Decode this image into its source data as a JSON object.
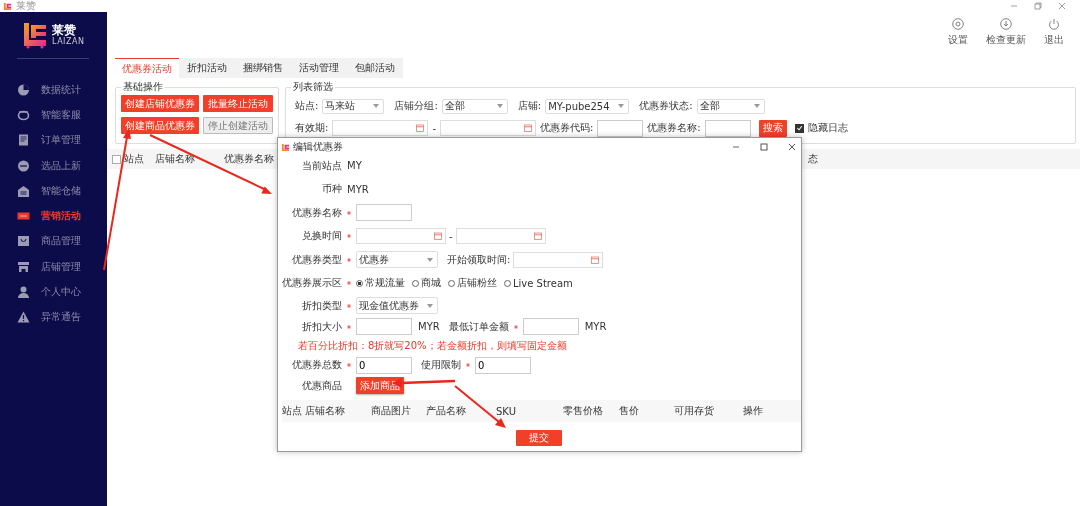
{
  "app_title": "莱赞",
  "logo": {
    "name": "莱赞",
    "subtitle": "LAIZAN"
  },
  "sidebar": {
    "items": [
      {
        "label": "数据统计",
        "kind": "chart",
        "selected": false
      },
      {
        "label": "智能客服",
        "kind": "service",
        "selected": false
      },
      {
        "label": "订单管理",
        "kind": "order",
        "selected": false
      },
      {
        "label": "选品上新",
        "kind": "new",
        "selected": false
      },
      {
        "label": "智能仓储",
        "kind": "warehouse",
        "selected": false
      },
      {
        "label": "营销活动",
        "kind": "sale",
        "selected": true
      },
      {
        "label": "商品管理",
        "kind": "bag",
        "selected": false
      },
      {
        "label": "店铺管理",
        "kind": "store",
        "selected": false
      },
      {
        "label": "个人中心",
        "kind": "person",
        "selected": false
      },
      {
        "label": "异常通告",
        "kind": "warning",
        "selected": false
      }
    ]
  },
  "toolbar": [
    {
      "label": "设置",
      "kind": "settings"
    },
    {
      "label": "检查更新",
      "kind": "update"
    },
    {
      "label": "退出",
      "kind": "power"
    }
  ],
  "tabs": [
    {
      "label": "优惠券活动",
      "selected": true
    },
    {
      "label": "折扣活动",
      "selected": false
    },
    {
      "label": "捆绑销售",
      "selected": false
    },
    {
      "label": "活动管理",
      "selected": false
    },
    {
      "label": "包邮活动",
      "selected": false
    }
  ],
  "basic_ops": {
    "title": "基础操作",
    "buttons": [
      {
        "label": "创建店铺优惠券",
        "disabled": false
      },
      {
        "label": "批量终止活动",
        "disabled": false
      },
      {
        "label": "创建商品优惠券",
        "disabled": false
      },
      {
        "label": "停止创建活动",
        "disabled": true
      }
    ]
  },
  "filters": {
    "title": "列表筛选",
    "selects": [
      {
        "label": "站点:",
        "value": "马来站"
      },
      {
        "label": "店铺分组:",
        "value": "全部"
      },
      {
        "label": "店铺:",
        "value": "MY-pube254"
      },
      {
        "label": "优惠券状态:",
        "value": "全部"
      }
    ],
    "validity_label": "有效期:",
    "separator": "-",
    "code_label": "优惠券代码:",
    "name_label": "优惠券名称:",
    "search_button": "搜索",
    "hide_log": {
      "label": "隐藏日志",
      "checked": true
    }
  },
  "table": {
    "select_all_checked": false,
    "columns": [
      "站点",
      "店铺名称",
      "优惠券名称",
      "态"
    ]
  },
  "dialog": {
    "title": "编辑优惠券",
    "info": [
      {
        "label": "当前站点",
        "value": "MY"
      },
      {
        "label": "币种",
        "value": "MYR"
      }
    ],
    "coupon_name": {
      "label": "优惠券名称",
      "required": true
    },
    "redeem_time": {
      "label": "兑换时间",
      "required": true,
      "separator": "-"
    },
    "coupon_type": {
      "label": "优惠券类型",
      "required": true,
      "value": "优惠券",
      "start_label": "开始领取时间:"
    },
    "display": {
      "label": "优惠券展示区",
      "required": true,
      "options": [
        {
          "label": "常规流量",
          "selected": true
        },
        {
          "label": "商城",
          "selected": false
        },
        {
          "label": "店铺粉丝",
          "selected": false
        },
        {
          "label": "Live Stream",
          "selected": false
        }
      ]
    },
    "discount_type": {
      "label": "折扣类型",
      "required": true,
      "value": "现金值优惠券"
    },
    "discount_amount": {
      "label": "折扣大小",
      "required": true,
      "unit": "MYR",
      "min_label": "最低订单金额",
      "min_required": true,
      "min_unit": "MYR"
    },
    "hint": "若百分比折扣：8折就写20%；若金额折扣，则填写固定金额",
    "total": {
      "label": "优惠券总数",
      "required": true,
      "value": "0",
      "limit_label": "使用限制",
      "limit_required": true,
      "limit_value": "0"
    },
    "products": {
      "label": "优惠商品",
      "button": "添加商品",
      "columns": [
        "站点",
        "店铺名称",
        "商品图片",
        "产品名称",
        "SKU",
        "零售价格",
        "售价",
        "可用存货",
        "操作"
      ]
    },
    "submit": "提交"
  }
}
